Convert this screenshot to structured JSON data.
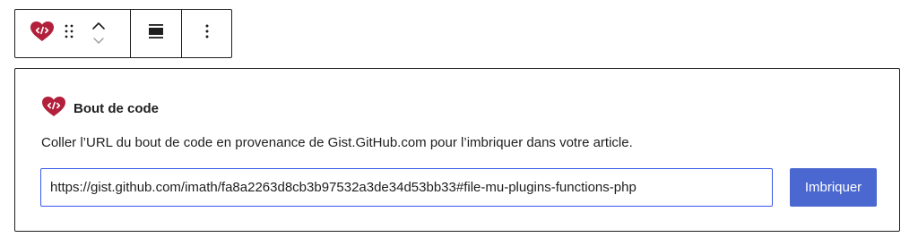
{
  "colors": {
    "accent": "#3858e9",
    "button_bg": "#4a68d0",
    "gist_icon": "#b2203b",
    "border": "#1e1e1e",
    "chevron_disabled": "#9a9a9a"
  },
  "toolbar": {
    "block_type_icon": "gist-heart-code-icon",
    "drag_icon": "drag-handle-icon",
    "move_up_icon": "chevron-up-icon",
    "move_down_icon": "chevron-down-icon",
    "align_icon": "align-wide-icon",
    "more_icon": "more-vertical-icon"
  },
  "placeholder": {
    "icon": "gist-heart-code-icon",
    "title": "Bout de code",
    "instructions": "Coller l’URL du bout de code en provenance de Gist.GitHub.com pour l’imbriquer dans votre article.",
    "url_value": "https://gist.github.com/imath/fa8a2263d8cb3b97532a3de34d53bb33#file-mu-plugins-functions-php",
    "embed_label": "Imbriquer"
  }
}
